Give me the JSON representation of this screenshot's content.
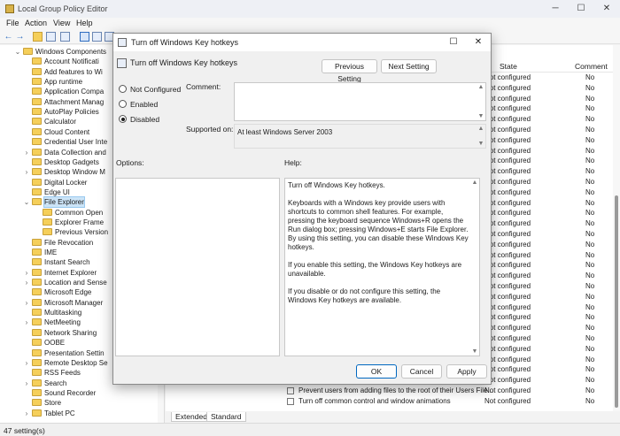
{
  "window": {
    "title": "Local Group Policy Editor",
    "min": "─",
    "max": "☐",
    "close": "✕"
  },
  "menu": [
    "File",
    "Action",
    "View",
    "Help"
  ],
  "toolbar": {
    "back": "←",
    "forward": "→"
  },
  "tree": {
    "items": [
      {
        "label": "Windows Components",
        "level": 0,
        "chevron": "⌄",
        "folder": true
      },
      {
        "label": "Account Notificati",
        "level": 1,
        "chevron": "",
        "folder": true
      },
      {
        "label": "Add features to Wi",
        "level": 1,
        "chevron": "",
        "folder": true
      },
      {
        "label": "App runtime",
        "level": 1,
        "chevron": "",
        "folder": true
      },
      {
        "label": "Application Compa",
        "level": 1,
        "chevron": "",
        "folder": true
      },
      {
        "label": "Attachment Manag",
        "level": 1,
        "chevron": "",
        "folder": true
      },
      {
        "label": "AutoPlay Policies",
        "level": 1,
        "chevron": "",
        "folder": true
      },
      {
        "label": "Calculator",
        "level": 1,
        "chevron": "",
        "folder": true
      },
      {
        "label": "Cloud Content",
        "level": 1,
        "chevron": "",
        "folder": true
      },
      {
        "label": "Credential User Inte",
        "level": 1,
        "chevron": "",
        "folder": true
      },
      {
        "label": "Data Collection and",
        "level": 1,
        "chevron": "›",
        "folder": true
      },
      {
        "label": "Desktop Gadgets",
        "level": 1,
        "chevron": "",
        "folder": true
      },
      {
        "label": "Desktop Window M",
        "level": 1,
        "chevron": "›",
        "folder": true
      },
      {
        "label": "Digital Locker",
        "level": 1,
        "chevron": "",
        "folder": true
      },
      {
        "label": "Edge UI",
        "level": 1,
        "chevron": "",
        "folder": true
      },
      {
        "label": "File Explorer",
        "level": 1,
        "chevron": "⌄",
        "folder": true,
        "selected": true
      },
      {
        "label": "Common Open",
        "level": 2,
        "chevron": "",
        "folder": true
      },
      {
        "label": "Explorer Frame",
        "level": 2,
        "chevron": "",
        "folder": true
      },
      {
        "label": "Previous Version",
        "level": 2,
        "chevron": "",
        "folder": true
      },
      {
        "label": "File Revocation",
        "level": 1,
        "chevron": "",
        "folder": true
      },
      {
        "label": "IME",
        "level": 1,
        "chevron": "",
        "folder": true
      },
      {
        "label": "Instant Search",
        "level": 1,
        "chevron": "",
        "folder": true
      },
      {
        "label": "Internet Explorer",
        "level": 1,
        "chevron": "›",
        "folder": true
      },
      {
        "label": "Location and Sense",
        "level": 1,
        "chevron": "›",
        "folder": true
      },
      {
        "label": "Microsoft Edge",
        "level": 1,
        "chevron": "",
        "folder": true
      },
      {
        "label": "Microsoft Manager",
        "level": 1,
        "chevron": "›",
        "folder": true
      },
      {
        "label": "Multitasking",
        "level": 1,
        "chevron": "",
        "folder": true
      },
      {
        "label": "NetMeeting",
        "level": 1,
        "chevron": "›",
        "folder": true
      },
      {
        "label": "Network Sharing",
        "level": 1,
        "chevron": "",
        "folder": true
      },
      {
        "label": "OOBE",
        "level": 1,
        "chevron": "",
        "folder": true
      },
      {
        "label": "Presentation Settin",
        "level": 1,
        "chevron": "",
        "folder": true
      },
      {
        "label": "Remote Desktop Se",
        "level": 1,
        "chevron": "›",
        "folder": true
      },
      {
        "label": "RSS Feeds",
        "level": 1,
        "chevron": "",
        "folder": true
      },
      {
        "label": "Search",
        "level": 1,
        "chevron": "›",
        "folder": true
      },
      {
        "label": "Sound Recorder",
        "level": 1,
        "chevron": "",
        "folder": true
      },
      {
        "label": "Store",
        "level": 1,
        "chevron": "",
        "folder": true
      },
      {
        "label": "Tablet PC",
        "level": 1,
        "chevron": "›",
        "folder": true
      }
    ]
  },
  "list": {
    "header": {
      "state": "State",
      "comment": "Comment"
    },
    "rows": [
      {
        "name": "",
        "state": "Not configured",
        "comment": "No"
      },
      {
        "name": "",
        "state": "Not configured",
        "comment": "No"
      },
      {
        "name": "",
        "state": "Not configured",
        "comment": "No"
      },
      {
        "name": "",
        "state": "Not configured",
        "comment": "No"
      },
      {
        "name": "",
        "state": "Not configured",
        "comment": "No"
      },
      {
        "name": "",
        "state": "Not configured",
        "comment": "No"
      },
      {
        "name": "",
        "state": "Not configured",
        "comment": "No"
      },
      {
        "name": "",
        "state": "Not configured",
        "comment": "No"
      },
      {
        "name": "",
        "state": "Not configured",
        "comment": "No"
      },
      {
        "name": "",
        "state": "Not configured",
        "comment": "No"
      },
      {
        "name": "",
        "state": "Not configured",
        "comment": "No"
      },
      {
        "name": "",
        "state": "Not configured",
        "comment": "No"
      },
      {
        "name": "",
        "state": "Not configured",
        "comment": "No"
      },
      {
        "name": "",
        "state": "Not configured",
        "comment": "No"
      },
      {
        "name": "",
        "state": "Not configured",
        "comment": "No"
      },
      {
        "name": "",
        "state": "Not configured",
        "comment": "No"
      },
      {
        "name": "",
        "state": "Not configured",
        "comment": "No"
      },
      {
        "name": "",
        "state": "Not configured",
        "comment": "No"
      },
      {
        "name": "",
        "state": "Not configured",
        "comment": "No"
      },
      {
        "name": "",
        "state": "Not configured",
        "comment": "No"
      },
      {
        "name": "",
        "state": "Not configured",
        "comment": "No"
      },
      {
        "name": "",
        "state": "Not configured",
        "comment": "No"
      },
      {
        "name": "",
        "state": "Not configured",
        "comment": "No"
      },
      {
        "name": "",
        "state": "Not configured",
        "comment": "No"
      },
      {
        "name": "",
        "state": "Not configured",
        "comment": "No"
      },
      {
        "name": "",
        "state": "Not configured",
        "comment": "No"
      },
      {
        "name": "",
        "state": "Not configured",
        "comment": "No"
      },
      {
        "name": "",
        "state": "Not configured",
        "comment": "No"
      },
      {
        "name": "",
        "state": "Not configured",
        "comment": "No"
      },
      {
        "name": "",
        "state": "Not configured",
        "comment": "No"
      },
      {
        "name": "Prevent users from adding files to the root of their Users File...",
        "state": "Not configured",
        "comment": "No"
      },
      {
        "name": "Turn off common control and window animations",
        "state": "Not configured",
        "comment": "No"
      }
    ]
  },
  "tabs": [
    "Extended",
    "Standard"
  ],
  "status": "47 setting(s)",
  "dialog": {
    "title": "Turn off Windows Key hotkeys",
    "setting_name": "Turn off Windows Key hotkeys",
    "prev_button": "Previous Setting",
    "next_button": "Next Setting",
    "radios": [
      {
        "label": "Not Configured",
        "checked": false
      },
      {
        "label": "Enabled",
        "checked": false
      },
      {
        "label": "Disabled",
        "checked": true
      }
    ],
    "comment_label": "Comment:",
    "supported_label": "Supported on:",
    "supported_value": "At least Windows Server 2003",
    "options_label": "Options:",
    "help_label": "Help:",
    "help_paragraphs": [
      "Turn off Windows Key hotkeys.",
      "Keyboards with a Windows key provide users with shortcuts to common shell features. For example, pressing the keyboard sequence Windows+R opens the Run dialog box; pressing Windows+E starts File Explorer. By using this setting, you can disable these Windows Key hotkeys.",
      "If you enable this setting, the Windows Key hotkeys are unavailable.",
      "If you disable or do not configure this setting, the Windows Key hotkeys are available."
    ],
    "ok": "OK",
    "cancel": "Cancel",
    "apply": "Apply",
    "max": "☐",
    "close": "✕"
  }
}
